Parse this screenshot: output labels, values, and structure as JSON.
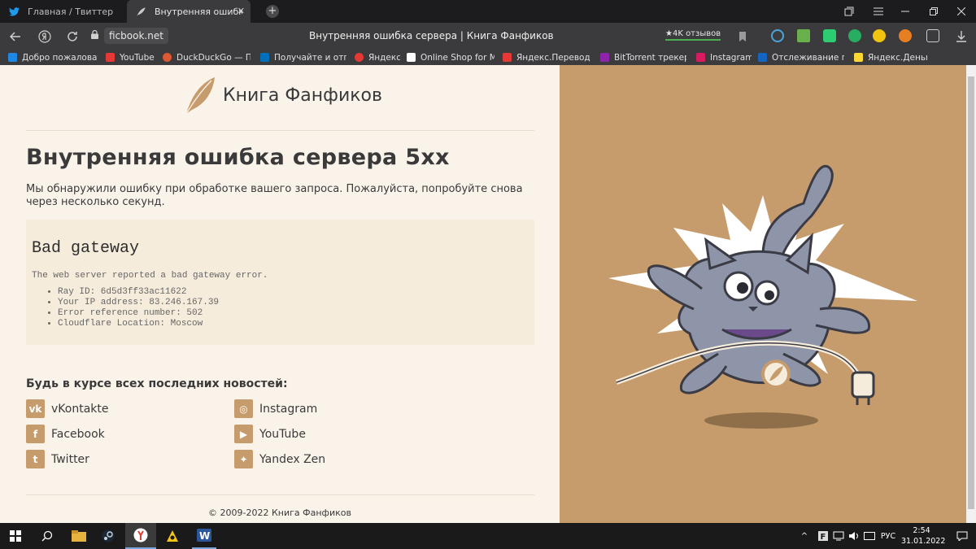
{
  "tabs": [
    {
      "title": "Главная / Твиттер",
      "icon": "twitter-icon"
    },
    {
      "title": "Внутренняя ошибка се",
      "icon": "feather-icon",
      "close": "✕"
    }
  ],
  "new_tab": "+",
  "address": {
    "url": "ficbook.net",
    "page_title": "Внутренняя ошибка сервера | Книга Фанфиков",
    "reviews": "★4K отзывов"
  },
  "bookmarks": [
    {
      "label": "Добро пожаловат",
      "color": "#1e88e5"
    },
    {
      "label": "YouTube",
      "color": "#e53935"
    },
    {
      "label": "DuckDuckGo — Пр",
      "color": "#de5833"
    },
    {
      "label": "Получайте и отпр",
      "color": "#0070ba"
    },
    {
      "label": "Яндекс",
      "color": "#e53935"
    },
    {
      "label": "Online Shop for M",
      "color": "#ffffff"
    },
    {
      "label": "Яндекс.Переводч",
      "color": "#e53935"
    },
    {
      "label": "BitTorrent трекер I",
      "color": "#8e24aa"
    },
    {
      "label": "Instagram",
      "color": "#d81b60"
    },
    {
      "label": "Отслеживание по",
      "color": "#1565c0"
    },
    {
      "label": "Яндекс.Деньги",
      "color": "#fdd835"
    }
  ],
  "logo": {
    "text": "Книга Фанфиков"
  },
  "error": {
    "heading": "Внутренняя ошибка сервера 5xx",
    "description": "Мы обнаружили ошибку при обработке вашего запроса. Пожалуйста, попробуйте снова через несколько секунд.",
    "box_title": "Bad gateway",
    "box_message": "The web server reported a bad gateway error.",
    "details": [
      "Ray ID: 6d5d3ff33ac11622",
      "Your IP address: 83.246.167.39",
      "Error reference number: 502",
      "Cloudflare Location: Moscow"
    ]
  },
  "news": {
    "heading": "Будь в курсе всех последних новостей:",
    "links": [
      {
        "label": "vKontakte",
        "icon": "vk-icon",
        "glyph": "vk"
      },
      {
        "label": "Instagram",
        "icon": "instagram-icon",
        "glyph": "◎"
      },
      {
        "label": "Facebook",
        "icon": "facebook-icon",
        "glyph": "f"
      },
      {
        "label": "YouTube",
        "icon": "youtube-icon",
        "glyph": "▶"
      },
      {
        "label": "Twitter",
        "icon": "twitter-icon",
        "glyph": "t"
      },
      {
        "label": "Yandex Zen",
        "icon": "zen-icon",
        "glyph": "✦"
      }
    ]
  },
  "footer": {
    "copyright": "© 2009-2022 Книга Фанфиков"
  },
  "taskbar": {
    "lang": "РУС",
    "time": "2:54",
    "date": "31.01.2022"
  },
  "colors": {
    "accent": "#c69c6d",
    "page_bg": "#faf3ea",
    "error_box": "#f5ecdc"
  }
}
